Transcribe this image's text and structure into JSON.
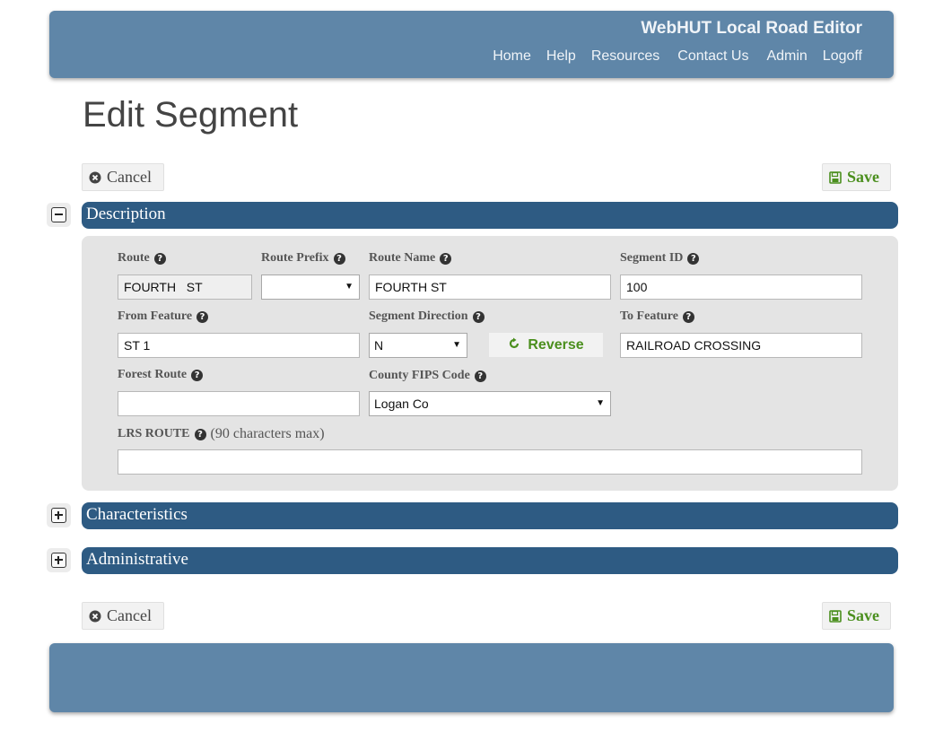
{
  "header": {
    "app_title": "WebHUT Local Road Editor",
    "nav": [
      "Home",
      "Help",
      "Resources",
      "Contact Us",
      "Admin",
      "Logoff"
    ]
  },
  "page_title": "Edit Segment",
  "toolbar": {
    "cancel_label": "Cancel",
    "save_label": "Save"
  },
  "sections": {
    "description": "Description",
    "characteristics": "Characteristics",
    "administrative": "Administrative"
  },
  "fields": {
    "route": {
      "label": "Route",
      "value": "FOURTH   ST"
    },
    "route_prefix": {
      "label": "Route Prefix",
      "value": ""
    },
    "route_name": {
      "label": "Route Name",
      "value": "FOURTH ST"
    },
    "segment_id": {
      "label": "Segment ID",
      "value": "100"
    },
    "from_feature": {
      "label": "From Feature",
      "value": "ST 1"
    },
    "segment_direction": {
      "label": "Segment Direction",
      "value": "N"
    },
    "reverse_label": "Reverse",
    "to_feature": {
      "label": "To Feature",
      "value": "RAILROAD CROSSING"
    },
    "forest_route": {
      "label": "Forest Route",
      "value": ""
    },
    "county_fips": {
      "label": "County FIPS Code",
      "value": "Logan Co"
    },
    "lrs_route": {
      "label": "LRS ROUTE",
      "hint": "(90 characters max)",
      "value": ""
    }
  },
  "colors": {
    "header_bg": "#5f86a8",
    "section_bar": "#2e5b83",
    "save_green": "#4b8f1e",
    "panel_bg": "#e4e4e4"
  },
  "icons": {
    "cancel": "x-circle-icon",
    "save": "floppy-disk-icon",
    "help": "question-circle-icon",
    "reverse": "rotate-icon"
  }
}
